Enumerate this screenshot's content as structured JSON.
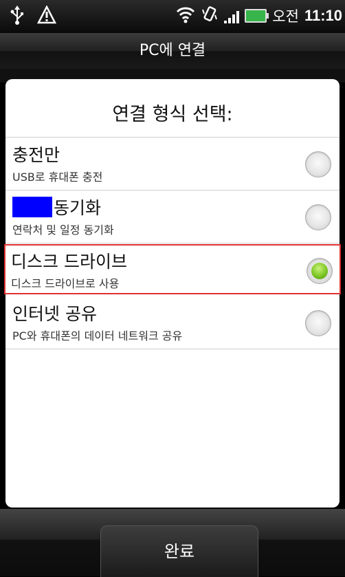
{
  "status_bar": {
    "ampm": "오전",
    "time": "11:10",
    "icons": [
      "usb-icon",
      "warning-icon",
      "wifi-icon",
      "vibrate-icon",
      "signal-icon",
      "battery-icon"
    ]
  },
  "title_bar": {
    "title": "PC에 연결"
  },
  "dialog": {
    "header": "연결 형식 선택:",
    "options": [
      {
        "title": "충전만",
        "subtitle": "USB로 휴대폰 충전",
        "selected": false
      },
      {
        "title": "동기화",
        "subtitle": "연락처 및 일정 동기화",
        "selected": false
      },
      {
        "title": "디스크 드라이브",
        "subtitle": "디스크 드라이브로 사용",
        "selected": true
      },
      {
        "title": "인터넷 공유",
        "subtitle": "PC와 휴대폰의 데이터 네트워크 공유",
        "selected": false
      }
    ]
  },
  "footer": {
    "done_label": "완료"
  },
  "colors": {
    "selected_radio": "#7cc624",
    "selection_outline": "#e03030",
    "redaction": "#0000ff"
  }
}
